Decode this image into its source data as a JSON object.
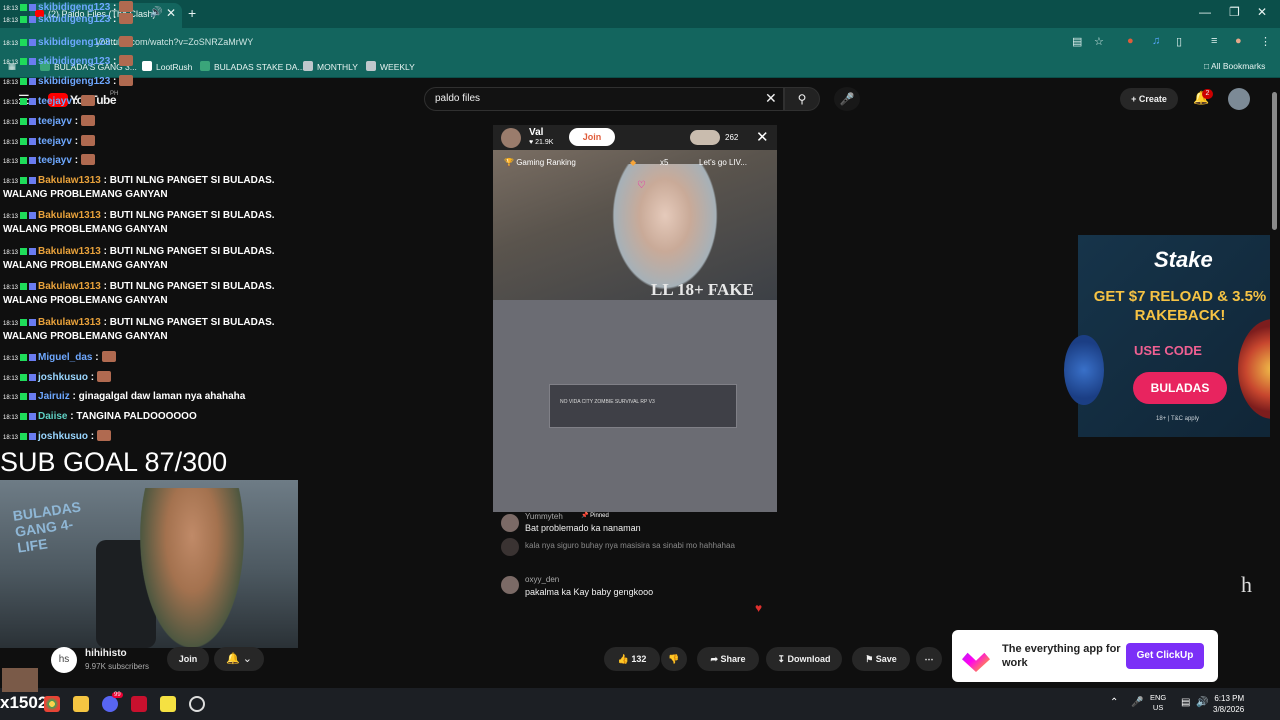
{
  "browser": {
    "tab_title": "(2) Paldo Files (The Clash)",
    "url": "youtube.com/watch?v=ZoSNRZaMrWY",
    "bookmarks": [
      {
        "label": "BULADA'S GANG 3...",
        "color": "#3aa57a"
      },
      {
        "label": "LootRush",
        "color": "#ffffff"
      },
      {
        "label": "BULADAS STAKE DA...",
        "color": "#3aa57a"
      },
      {
        "label": "MONTHLY",
        "color": "#bfc7cc"
      },
      {
        "label": "WEEKLY",
        "color": "#bfc7cc"
      }
    ],
    "all_bookmarks": "All Bookmarks"
  },
  "youtube": {
    "logo": "YouTube",
    "logo_region": "PH",
    "search_value": "paldo files",
    "create_label": "Create",
    "notification_count": "2"
  },
  "overlay": {
    "chat": [
      {
        "time": "18:13",
        "user": "skibidigeng123",
        "sep": " :",
        "msg": "",
        "color": "#6ea8ff"
      },
      {
        "time": "18:13",
        "user": "skibidigeng123",
        "sep": " :",
        "msg": "",
        "color": "#6ea8ff"
      },
      {
        "time": "18:13",
        "user": "skibidigeng123",
        "sep": " :",
        "msg": "",
        "color": "#6ea8ff"
      },
      {
        "time": "18:13",
        "user": "skibidigeng123",
        "sep": " :",
        "msg": "",
        "color": "#6ea8ff"
      },
      {
        "time": "18:13",
        "user": "skibidigeng123",
        "sep": " :",
        "msg": "",
        "color": "#6ea8ff"
      },
      {
        "time": "18:13",
        "user": "teejayv",
        "sep": " :",
        "msg": "",
        "color": "#6ea8ff"
      },
      {
        "time": "18:13",
        "user": "teejayv",
        "sep": " :",
        "msg": "",
        "color": "#6ea8ff"
      },
      {
        "time": "18:13",
        "user": "teejayv",
        "sep": " :",
        "msg": "",
        "color": "#6ea8ff"
      },
      {
        "time": "18:13",
        "user": "teejayv",
        "sep": " :",
        "msg": "",
        "color": "#6ea8ff"
      },
      {
        "time": "18:13",
        "user": "Bakulaw1313",
        "sep": " :",
        "msg": " BUTI NLNG PANGET SI BULADAS.",
        "color": "#e9a23b"
      },
      {
        "time": "",
        "user": "",
        "sep": "",
        "msg": "WALANG PROBLEMANG GANYAN",
        "color": "#ffffff"
      },
      {
        "time": "18:13",
        "user": "Bakulaw1313",
        "sep": " :",
        "msg": " BUTI NLNG PANGET SI BULADAS.",
        "color": "#e9a23b"
      },
      {
        "time": "",
        "user": "",
        "sep": "",
        "msg": "WALANG PROBLEMANG GANYAN",
        "color": "#ffffff"
      },
      {
        "time": "18:13",
        "user": "Bakulaw1313",
        "sep": " :",
        "msg": " BUTI NLNG PANGET SI BULADAS.",
        "color": "#e9a23b"
      },
      {
        "time": "",
        "user": "",
        "sep": "",
        "msg": "WALANG PROBLEMANG GANYAN",
        "color": "#ffffff"
      },
      {
        "time": "18:13",
        "user": "Bakulaw1313",
        "sep": " :",
        "msg": " BUTI NLNG PANGET SI BULADAS.",
        "color": "#e9a23b"
      },
      {
        "time": "",
        "user": "",
        "sep": "",
        "msg": "WALANG PROBLEMANG GANYAN",
        "color": "#ffffff"
      },
      {
        "time": "18:13",
        "user": "Bakulaw1313",
        "sep": " :",
        "msg": " BUTI NLNG PANGET SI BULADAS.",
        "color": "#e9a23b"
      },
      {
        "time": "",
        "user": "",
        "sep": "",
        "msg": "WALANG PROBLEMANG GANYAN",
        "color": "#ffffff"
      },
      {
        "time": "18:13",
        "user": "Miguel_das",
        "sep": " :",
        "msg": "",
        "color": "#6ea8ff"
      },
      {
        "time": "18:13",
        "user": "joshkusuo",
        "sep": " :",
        "msg": "",
        "color": "#9ad6ff"
      },
      {
        "time": "18:13",
        "user": "Jairuiz",
        "sep": " :",
        "msg": " ginagalgal daw laman nya ahahaha",
        "color": "#6ea8ff"
      },
      {
        "time": "18:13",
        "user": "Daiise",
        "sep": " :",
        "msg": " TANGINA PALDOOOOOO",
        "color": "#5fd0c4"
      },
      {
        "time": "18:13",
        "user": "joshkusuo",
        "sep": " :",
        "msg": "",
        "color": "#9ad6ff"
      }
    ],
    "sub_goal": "SUB GOAL 87/300",
    "webcam_art": "BULADAS GANG 4-LIFE",
    "corner_tag": "x1502"
  },
  "shorts_player": {
    "streamer": "Val",
    "likes": "21.9K",
    "join_label": "Join",
    "viewers": "262",
    "ranking_label": "Gaming Ranking",
    "multiplier": "x5",
    "promo": "Let's go LIV...",
    "watermark": "LL 18+   FAKE",
    "game_title": "NO VIDA CITY ZOMBIE SURVIVAL RP V3",
    "comments": [
      {
        "user": "Yummyteh",
        "pinned": "Pinned",
        "text": "Bat problemado ka nanaman"
      },
      {
        "user": "",
        "pinned": "",
        "text": "kala nya siguro buhay nya masisira sa sinabi mo hahhahaa"
      },
      {
        "user": "oxyy_den",
        "pinned": "",
        "text": "pakalma ka Kay baby gengkooo"
      }
    ]
  },
  "stake_ad": {
    "logo": "Stake",
    "headline": "GET $7 RELOAD & 3.5% RAKEBACK!",
    "code_label": "USE CODE",
    "code": "BULADAS",
    "tc": "18+ | T&C apply"
  },
  "overlay_letter": "h",
  "video_footer": {
    "channel_name": "hihihisto",
    "channel_initials": "hs",
    "subscribers": "9.97K subscribers",
    "join_label": "Join",
    "likes": "132",
    "share_label": "Share",
    "download_label": "Download",
    "save_label": "Save"
  },
  "clickup_ad": {
    "text": "The everything app for work",
    "button": "Get ClickUp"
  },
  "taskbar": {
    "lang_top": "ENG",
    "lang_bottom": "US",
    "time": "6:13 PM",
    "date": "3/8/2026",
    "discord_badge": "99"
  },
  "colors": {
    "chrome_tab": "#0b4f4a",
    "chrome_bar": "#13655e",
    "youtube_bg": "#0f0f0f",
    "stake_pink": "#e8245f",
    "clickup_purple": "#7b2ff7"
  }
}
